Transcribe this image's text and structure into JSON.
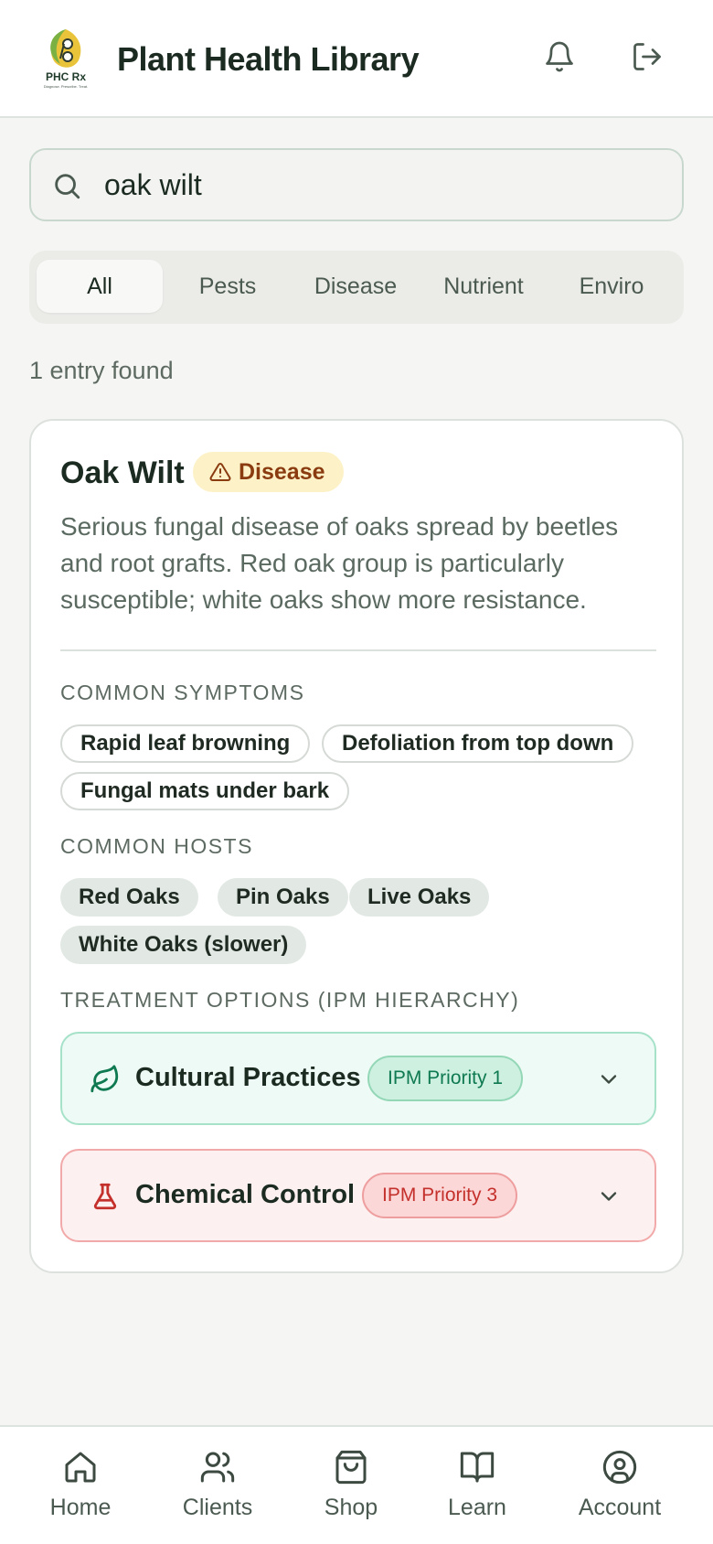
{
  "header": {
    "title": "Plant Health Library",
    "logo_text": "PHC Rx",
    "logo_tagline": "Diagnose. Prescribe. Treat.",
    "icons": [
      "bell-icon",
      "logout-icon"
    ]
  },
  "search": {
    "value": "oak wilt",
    "icon": "search-icon"
  },
  "tabs": [
    {
      "label": "All",
      "active": true
    },
    {
      "label": "Pests",
      "active": false
    },
    {
      "label": "Disease",
      "active": false
    },
    {
      "label": "Nutrient",
      "active": false
    },
    {
      "label": "Enviro",
      "active": false
    }
  ],
  "results": {
    "count_text": "1 entry found"
  },
  "entry": {
    "title": "Oak Wilt",
    "category_badge": "Disease",
    "badge_icon": "warning-triangle-icon",
    "description": "Serious fungal disease of oaks spread by beetles and root grafts. Red oak group is particularly susceptible; white oaks show more resistance.",
    "symptoms_label": "COMMON SYMPTOMS",
    "symptoms": [
      "Rapid leaf browning",
      "Defoliation from top down",
      "Fungal mats under bark"
    ],
    "hosts_label": "COMMON HOSTS",
    "hosts": [
      "Red Oaks",
      "Pin Oaks",
      "Live Oaks",
      "White Oaks (slower)"
    ],
    "treatment_label": "TREATMENT OPTIONS (IPM HIERARCHY)",
    "treatments": [
      {
        "label": "Cultural Practices",
        "priority": "IPM Priority 1",
        "icon": "leaf-icon",
        "color": "#0f7a52"
      },
      {
        "label": "Chemical Control",
        "priority": "IPM Priority 3",
        "icon": "flask-icon",
        "color": "#c4302b"
      }
    ]
  },
  "nav": [
    {
      "label": "Home",
      "icon": "home-icon"
    },
    {
      "label": "Clients",
      "icon": "users-icon"
    },
    {
      "label": "Shop",
      "icon": "shopping-bag-icon"
    },
    {
      "label": "Learn",
      "icon": "book-icon"
    },
    {
      "label": "Account",
      "icon": "user-circle-icon"
    }
  ],
  "colors": {
    "background": "#f5f5f3",
    "accent_green": "#0f7a52",
    "accent_red": "#c4302b",
    "disease_badge_bg": "#fdf2c7",
    "disease_badge_text": "#8a3b10"
  }
}
